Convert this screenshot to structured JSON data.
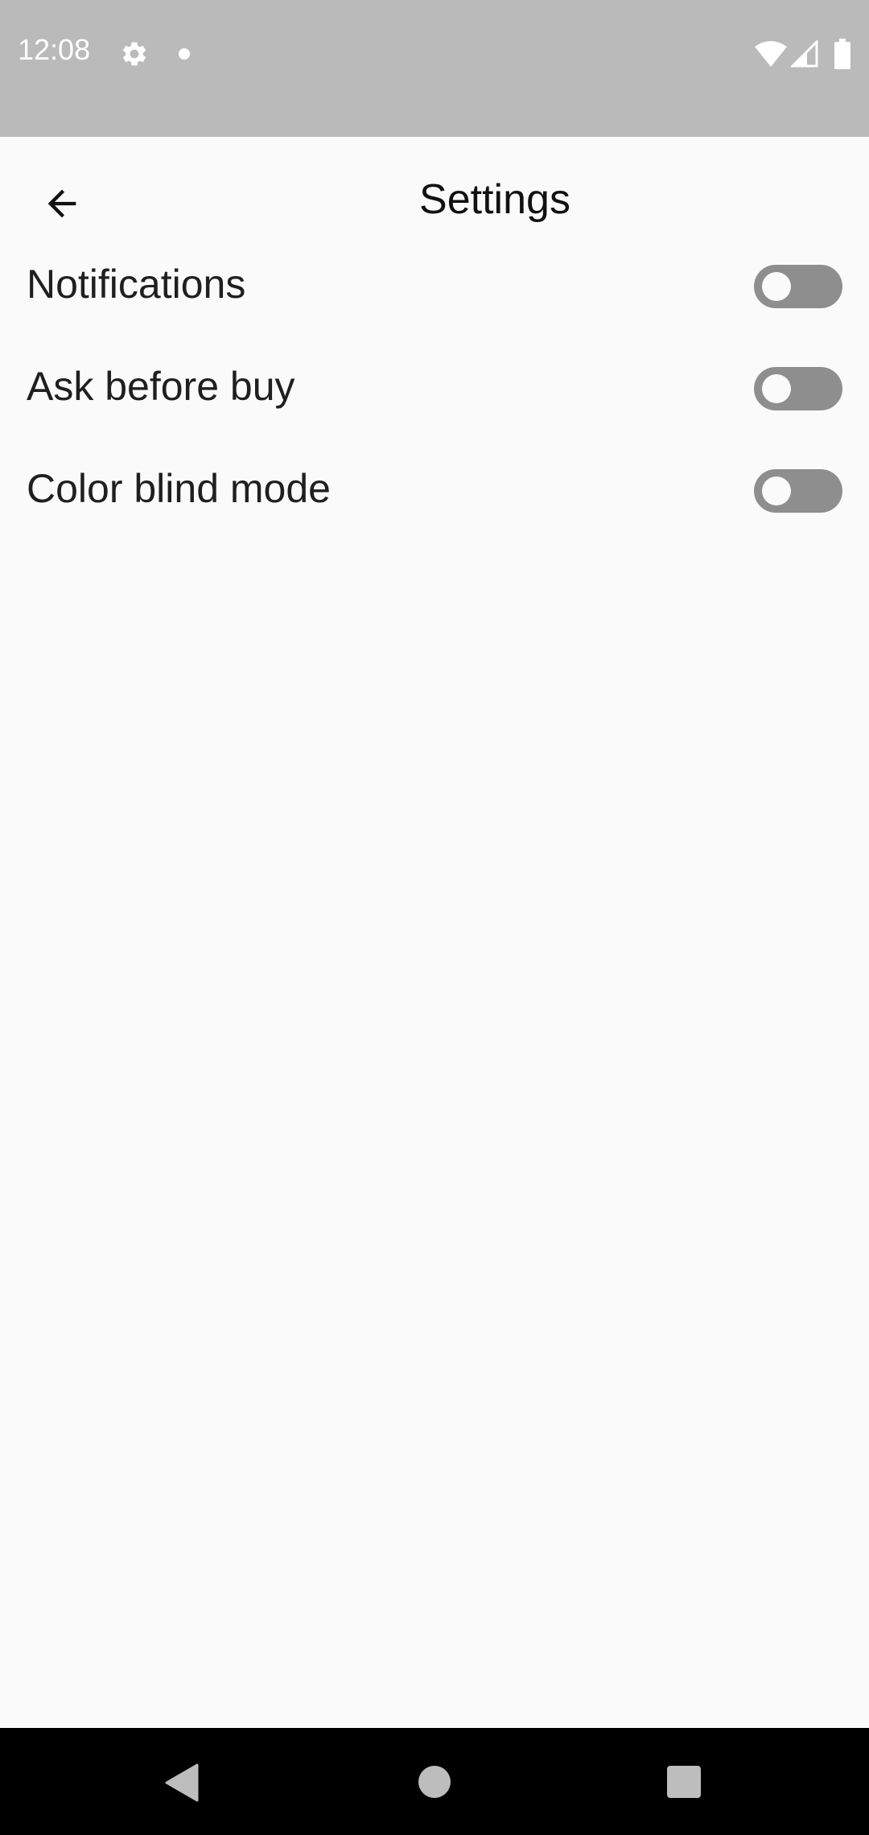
{
  "status_bar": {
    "time": "12:08",
    "icons": [
      "settings-gear-icon",
      "notification-dot-icon",
      "wifi-icon",
      "cell-signal-icon",
      "battery-icon"
    ]
  },
  "app_bar": {
    "title": "Settings",
    "back_icon": "arrow-left-icon"
  },
  "settings": {
    "items": [
      {
        "label": "Notifications",
        "enabled": false
      },
      {
        "label": "Ask before buy",
        "enabled": false
      },
      {
        "label": "Color blind mode",
        "enabled": false
      }
    ]
  },
  "nav_bar": {
    "icons": [
      "back-triangle-icon",
      "home-circle-icon",
      "recents-square-icon"
    ]
  },
  "colors": {
    "status_bar_bg": "#bababa",
    "page_bg": "#fafafa",
    "toggle_off_track": "#8e8e8e",
    "nav_bar_bg": "#000000"
  }
}
